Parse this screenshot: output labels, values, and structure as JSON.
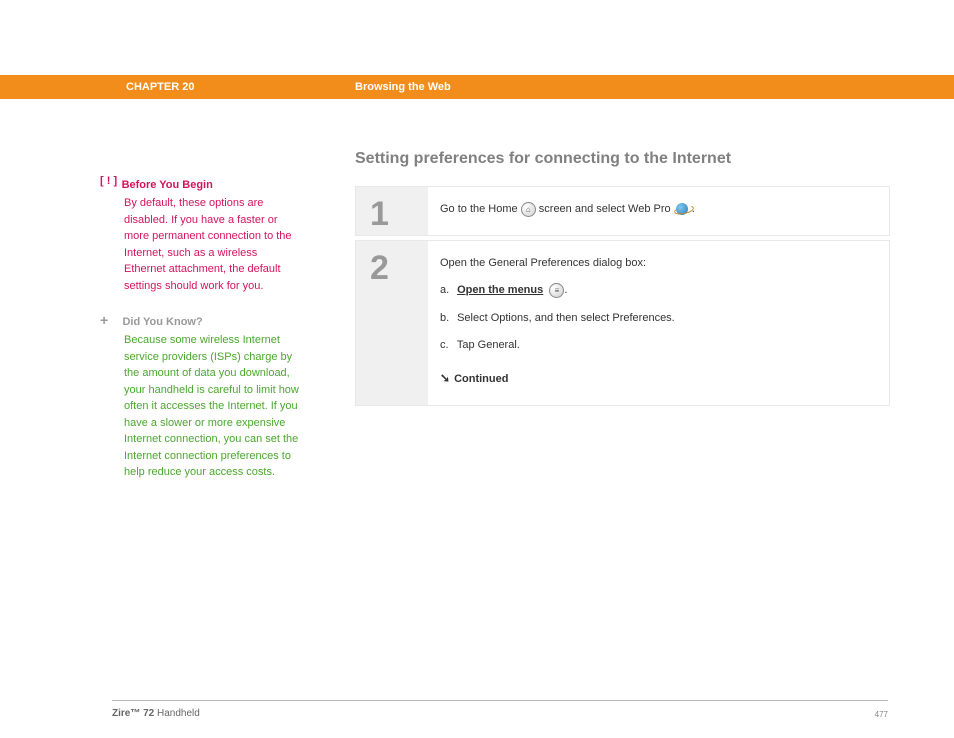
{
  "header": {
    "chapter": "CHAPTER 20",
    "title": "Browsing the Web"
  },
  "sidebar": {
    "before": {
      "icon": "[ ! ]",
      "title": "Before You Begin",
      "body": "By default, these options are disabled. If you have a faster or more permanent connection to the Internet, such as a wireless Ethernet attachment, the default settings should work for you."
    },
    "dyk": {
      "icon": "+",
      "title": "Did You Know?",
      "body": "Because some wireless Internet service providers (ISPs) charge by the amount of data you download, your handheld is careful to limit how often it accesses the Internet. If you have a slower or more expensive Internet connection, you can set the Internet connection preferences to help reduce your access costs."
    }
  },
  "main": {
    "sectionTitle": "Setting preferences for connecting to the Internet",
    "steps": [
      {
        "num": "1",
        "text_before_home": "Go to the Home ",
        "text_mid": " screen and select Web Pro ",
        "text_after": "."
      },
      {
        "num": "2",
        "intro": "Open the General Preferences dialog box:",
        "a_letter": "a.",
        "a_link": "Open the menus",
        "a_after": ".",
        "b_letter": "b.",
        "b_text": "Select Options, and then select Preferences.",
        "c_letter": "c.",
        "c_text": "Tap General.",
        "continued": "Continued"
      }
    ]
  },
  "footer": {
    "product_bold": "Zire™ 72",
    "product_rest": " Handheld",
    "page": "477"
  }
}
